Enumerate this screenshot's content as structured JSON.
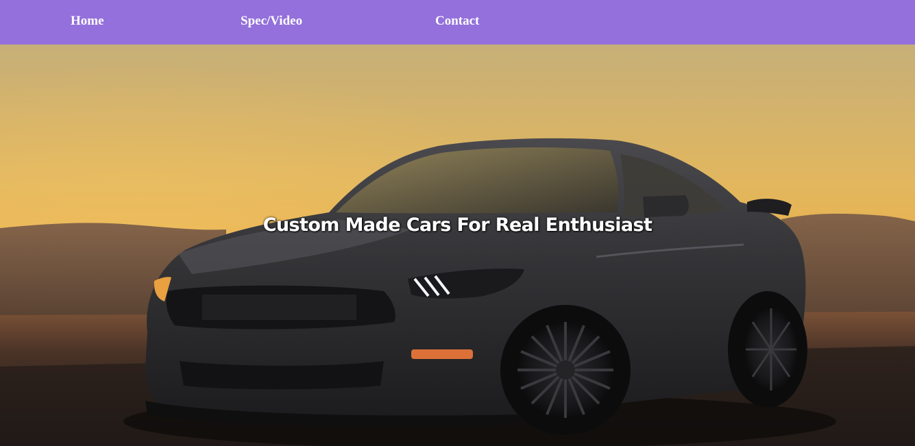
{
  "nav": {
    "links": [
      {
        "label": "Home"
      },
      {
        "label": "Spec/Video"
      },
      {
        "label": "Contact"
      }
    ],
    "background": "#9370DB"
  },
  "hero": {
    "heading": "Custom Made Cars For Real Enthusiast",
    "image": "dark-grey-sports-car-at-sunset-photo"
  },
  "colors": {
    "nav_bg": "#9370DB",
    "text": "#FFFFFF",
    "sky_top": "#C9B07A",
    "sky_mid": "#E6B45A",
    "ground": "#2A2320"
  }
}
